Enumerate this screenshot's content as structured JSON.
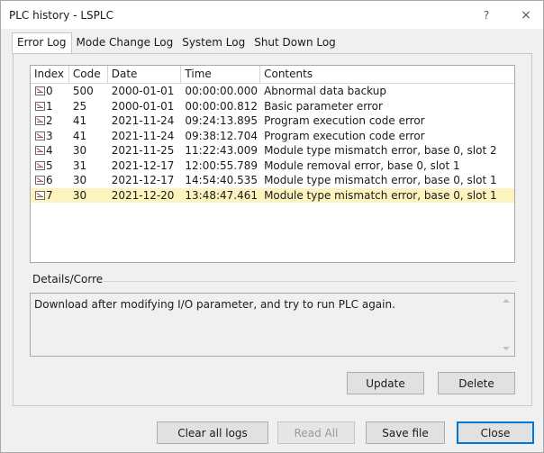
{
  "window": {
    "title": "PLC history - LSPLC",
    "help_glyph": "?",
    "close_glyph": "×"
  },
  "tabs": [
    {
      "label": "Error Log",
      "active": true
    },
    {
      "label": "Mode Change Log",
      "active": false
    },
    {
      "label": "System Log",
      "active": false
    },
    {
      "label": "Shut Down Log",
      "active": false
    }
  ],
  "table": {
    "columns": [
      "Index",
      "Code",
      "Date",
      "Time",
      "Contents"
    ],
    "rows": [
      {
        "index": "0",
        "code": "500",
        "date": "2000-01-01",
        "time": "00:00:00.000",
        "contents": "Abnormal data backup"
      },
      {
        "index": "1",
        "code": "25",
        "date": "2000-01-01",
        "time": "00:00:00.812",
        "contents": "Basic parameter error"
      },
      {
        "index": "2",
        "code": "41",
        "date": "2021-11-24",
        "time": "09:24:13.895",
        "contents": "Program execution code error"
      },
      {
        "index": "3",
        "code": "41",
        "date": "2021-11-24",
        "time": "09:38:12.704",
        "contents": "Program execution code error"
      },
      {
        "index": "4",
        "code": "30",
        "date": "2021-11-25",
        "time": "11:22:43.009",
        "contents": "Module type mismatch error, base 0, slot 2"
      },
      {
        "index": "5",
        "code": "31",
        "date": "2021-12-17",
        "time": "12:00:55.789",
        "contents": "Module removal error, base 0, slot 1"
      },
      {
        "index": "6",
        "code": "30",
        "date": "2021-12-17",
        "time": "14:54:40.535",
        "contents": "Module type mismatch error, base 0, slot 1"
      },
      {
        "index": "7",
        "code": "30",
        "date": "2021-12-20",
        "time": "13:48:47.461",
        "contents": "Module type mismatch error, base 0, slot 1"
      }
    ],
    "selected_row": 7,
    "row_icon": "event-log-icon",
    "selected_color": "#fdf3bf"
  },
  "details": {
    "label": "Details/Corre",
    "text": "Download after modifying I/O parameter, and try to run PLC again."
  },
  "panel_buttons": {
    "update": "Update",
    "delete": "Delete"
  },
  "footer_buttons": {
    "clear_all_logs": "Clear all logs",
    "read_all": "Read All",
    "save_file": "Save file",
    "close": "Close"
  },
  "colors": {
    "focus_border": "#0078d7",
    "window_bg": "#f0f0f0"
  }
}
